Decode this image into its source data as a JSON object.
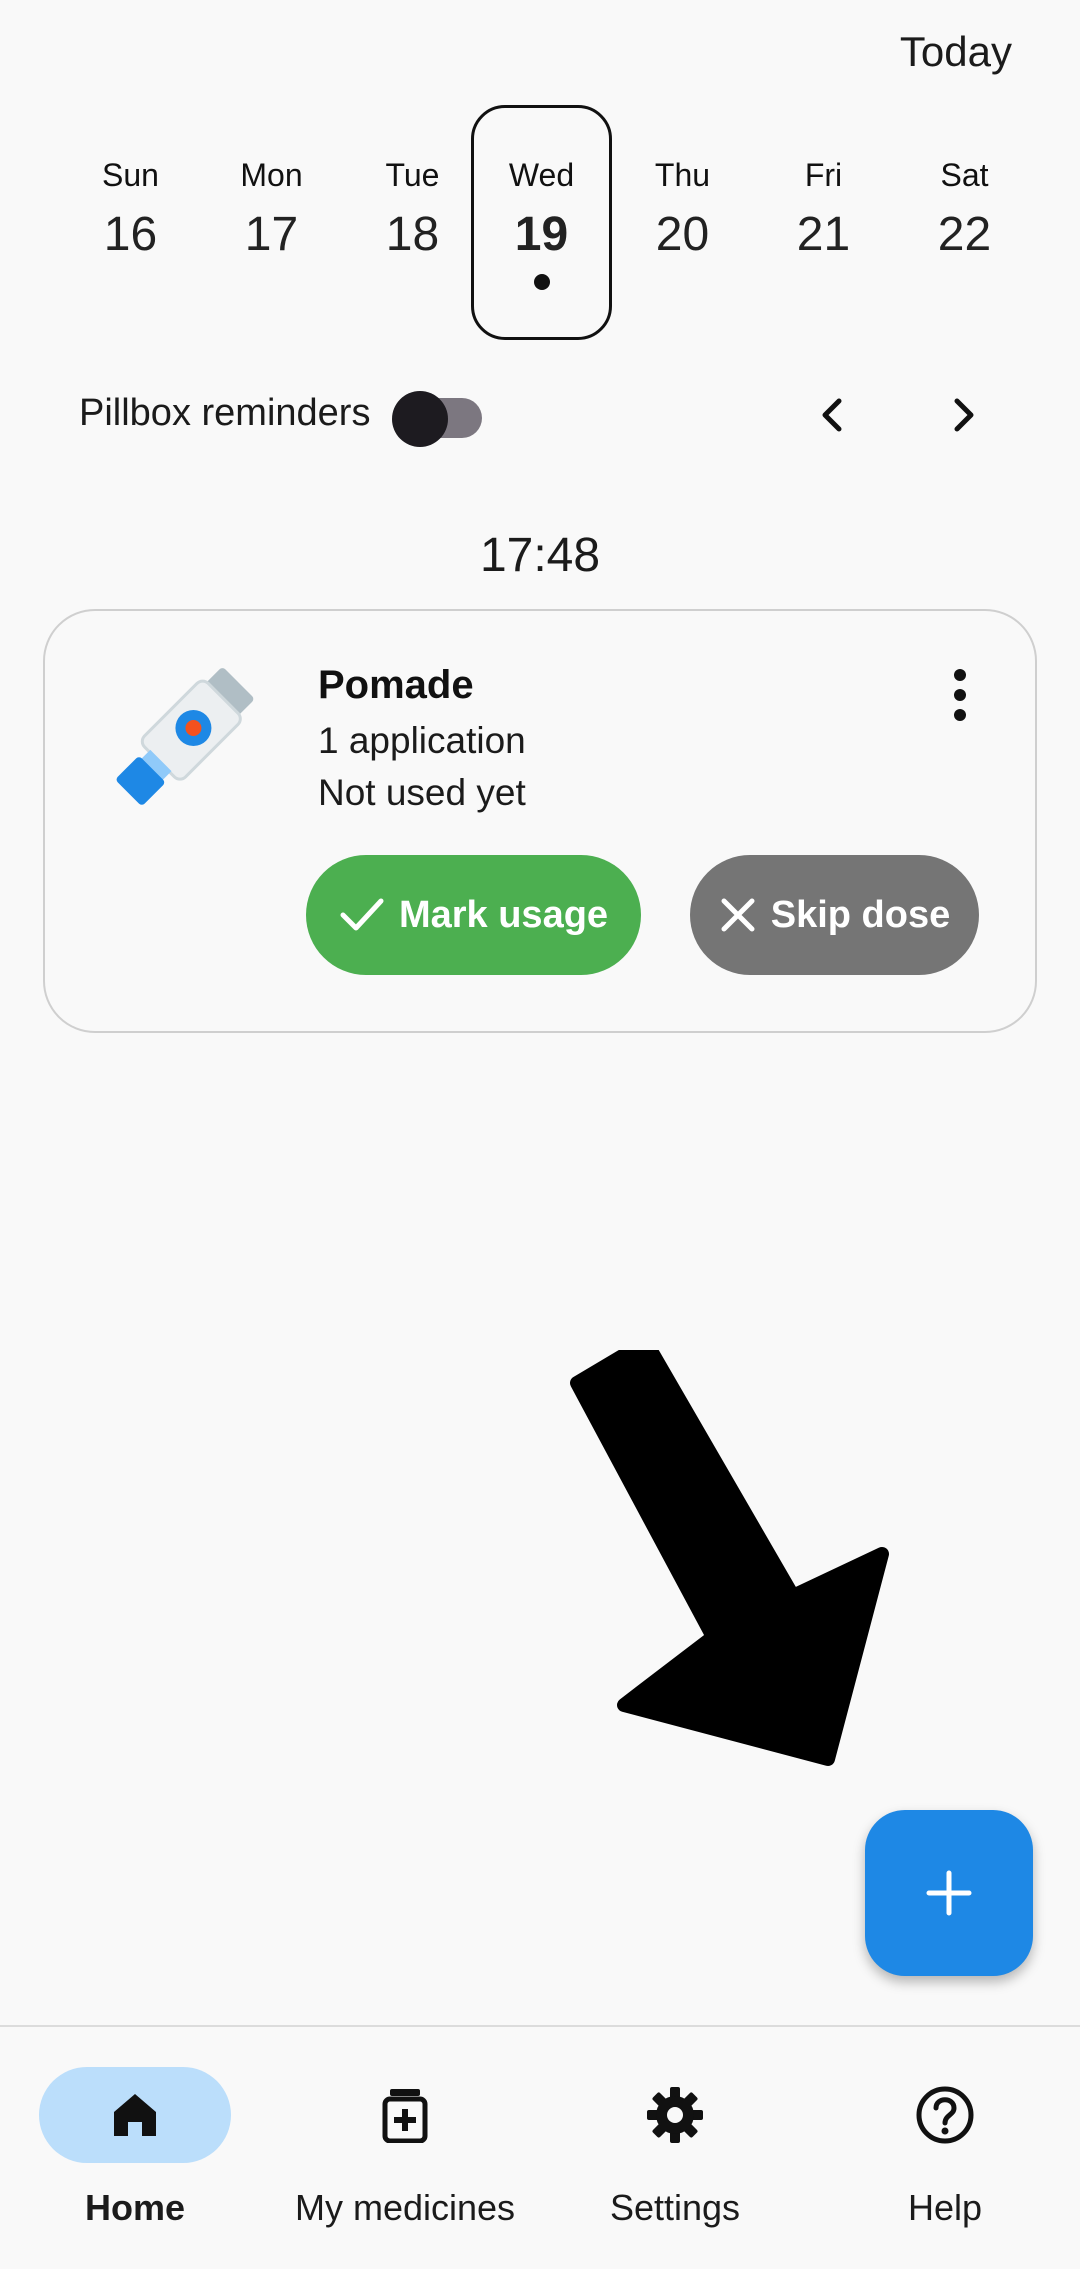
{
  "header": {
    "today_label": "Today"
  },
  "week": [
    {
      "name": "Sun",
      "num": "16"
    },
    {
      "name": "Mon",
      "num": "17"
    },
    {
      "name": "Tue",
      "num": "18"
    },
    {
      "name": "Wed",
      "num": "19",
      "selected": true
    },
    {
      "name": "Thu",
      "num": "20"
    },
    {
      "name": "Fri",
      "num": "21"
    },
    {
      "name": "Sat",
      "num": "22"
    }
  ],
  "pillbox": {
    "label": "Pillbox reminders",
    "enabled": false
  },
  "schedule": {
    "time": "17:48",
    "item": {
      "name": "Pomade",
      "dose": "1 application",
      "status": "Not used yet",
      "icon": "ointment-tube-icon",
      "mark_label": "Mark usage",
      "skip_label": "Skip dose"
    }
  },
  "bottom_nav": [
    {
      "label": "Home",
      "icon": "home-icon",
      "active": true
    },
    {
      "label": "My medicines",
      "icon": "medicine-bottle-icon"
    },
    {
      "label": "Settings",
      "icon": "gear-icon"
    },
    {
      "label": "Help",
      "icon": "help-icon"
    }
  ],
  "colors": {
    "accent": "#1e88e5",
    "mark_button": "#4caf50",
    "skip_button": "#757575",
    "nav_active": "#bbdefb"
  }
}
